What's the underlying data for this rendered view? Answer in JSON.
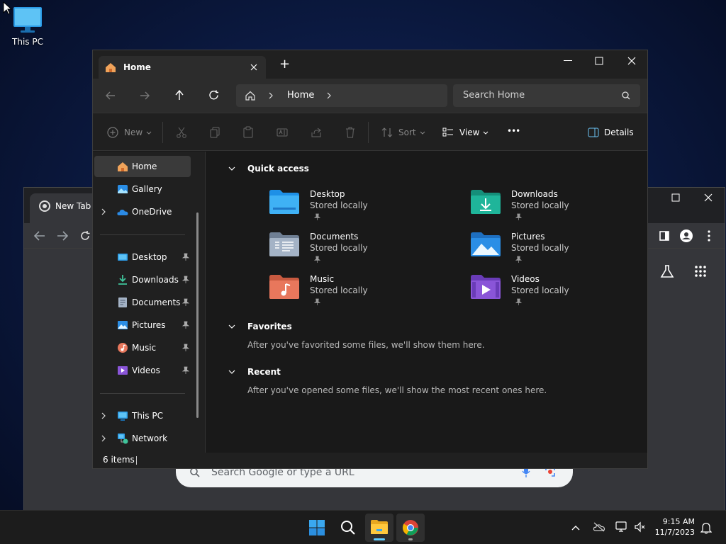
{
  "desktop": {
    "this_pc_label": "This PC"
  },
  "chrome": {
    "tab_title": "New Tab",
    "search_placeholder": "Search Google or type a URL"
  },
  "explorer": {
    "tab_title": "Home",
    "new_tab_symbol": "+",
    "breadcrumb": {
      "current": "Home"
    },
    "search_placeholder": "Search Home",
    "toolbar": {
      "new_label": "New",
      "sort_label": "Sort",
      "view_label": "View",
      "more_label": "•••",
      "details_label": "Details"
    },
    "sidebar": {
      "top": [
        {
          "label": "Home",
          "icon": "home-icon",
          "selected": true
        },
        {
          "label": "Gallery",
          "icon": "gallery-icon"
        },
        {
          "label": "OneDrive",
          "icon": "onedrive-icon",
          "expandable": true
        }
      ],
      "pinned": [
        {
          "label": "Desktop",
          "icon": "desktop-folder-icon"
        },
        {
          "label": "Downloads",
          "icon": "downloads-icon"
        },
        {
          "label": "Documents",
          "icon": "documents-icon"
        },
        {
          "label": "Pictures",
          "icon": "pictures-icon"
        },
        {
          "label": "Music",
          "icon": "music-icon"
        },
        {
          "label": "Videos",
          "icon": "videos-icon"
        }
      ],
      "bottom": [
        {
          "label": "This PC",
          "icon": "this-pc-icon"
        },
        {
          "label": "Network",
          "icon": "network-icon"
        }
      ]
    },
    "quick_access": {
      "title": "Quick access",
      "items": [
        {
          "name": "Desktop",
          "status": "Stored locally",
          "color": "#1e90e6"
        },
        {
          "name": "Downloads",
          "status": "Stored locally",
          "color": "#1fb59a"
        },
        {
          "name": "Documents",
          "status": "Stored locally",
          "color": "#8c9db4"
        },
        {
          "name": "Pictures",
          "status": "Stored locally",
          "color": "#2a8ee6"
        },
        {
          "name": "Music",
          "status": "Stored locally",
          "color": "#e8775c"
        },
        {
          "name": "Videos",
          "status": "Stored locally",
          "color": "#8a55d8"
        }
      ]
    },
    "favorites": {
      "title": "Favorites",
      "note": "After you've favorited some files, we'll show them here."
    },
    "recent": {
      "title": "Recent",
      "note": "After you've opened some files, we'll show the most recent ones here."
    },
    "status_bar": {
      "count": "6 items"
    }
  },
  "taskbar": {
    "time": "9:15 AM",
    "date": "11/7/2023"
  },
  "colors": {
    "accent": "#60cdff",
    "explorer_bg": "#191919",
    "taskbar_bg": "#1c1c1c"
  }
}
